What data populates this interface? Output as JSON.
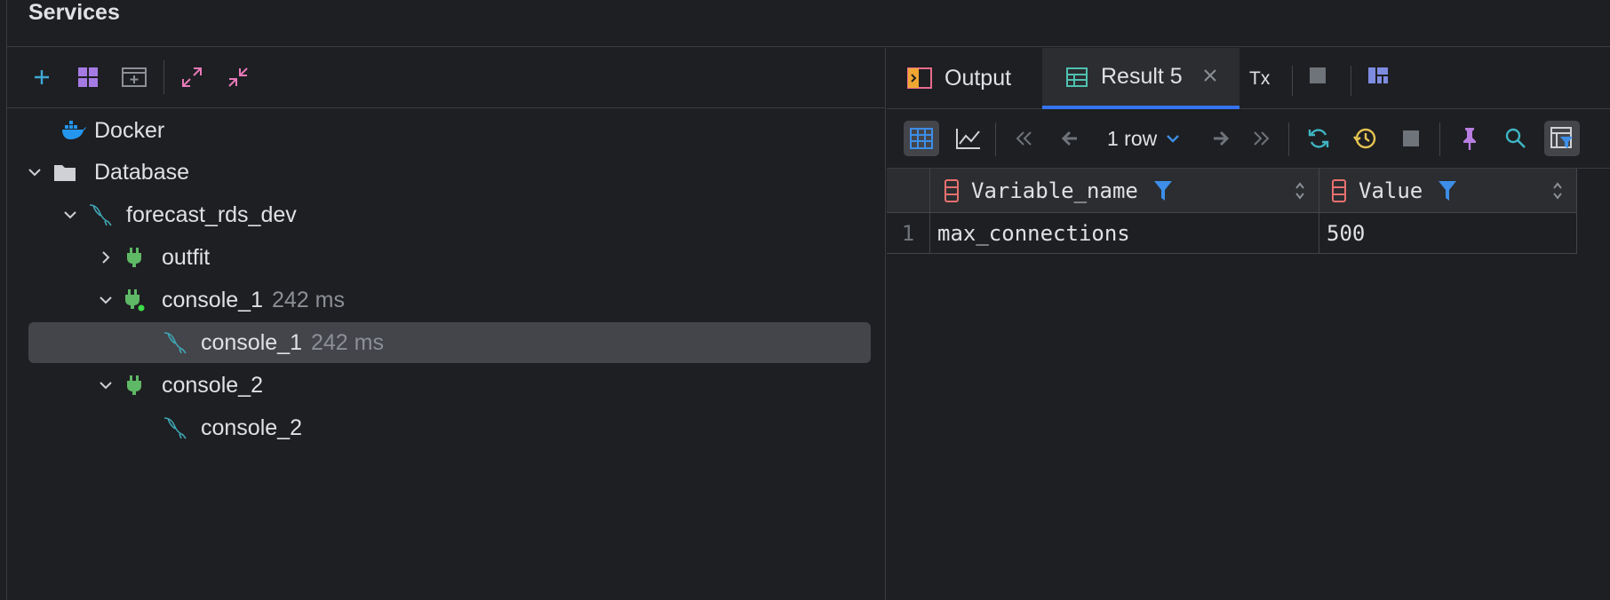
{
  "panel": {
    "title": "Services"
  },
  "left_toolbar": {
    "icons": [
      "add-icon",
      "group-icon",
      "new-tab-icon",
      "expand-all-icon",
      "collapse-all-icon"
    ]
  },
  "tree": {
    "docker": {
      "label": "Docker"
    },
    "database": {
      "label": "Database"
    },
    "datasource": {
      "label": "forecast_rds_dev"
    },
    "outfit": {
      "label": "outfit"
    },
    "console_1": {
      "label": "console_1",
      "time": "242 ms"
    },
    "console_1_child": {
      "label": "console_1",
      "time": "242 ms"
    },
    "console_2": {
      "label": "console_2"
    },
    "console_2_child": {
      "label": "console_2"
    }
  },
  "tabs": {
    "output": {
      "label": "Output"
    },
    "result": {
      "label": "Result 5"
    },
    "tx": {
      "label": "Tx"
    }
  },
  "result_toolbar": {
    "row_count": "1 row"
  },
  "grid": {
    "columns": [
      "Variable_name",
      "Value"
    ],
    "rows": [
      {
        "num": "1",
        "variable_name": "max_connections",
        "value": "500"
      }
    ]
  },
  "colors": {
    "accent": "#3574f0",
    "background": "#1e1f22",
    "selection": "#43454a",
    "plug_green": "#5fb865",
    "mysql_teal": "#3fa7b5"
  }
}
